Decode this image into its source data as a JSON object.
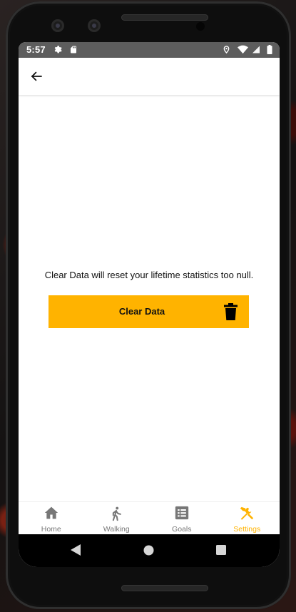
{
  "status_bar": {
    "time": "5:57",
    "left_icons": [
      "gear-icon",
      "sd-card-icon"
    ],
    "right_icons": [
      "location-icon",
      "wifi-icon",
      "signal-icon",
      "battery-icon"
    ]
  },
  "app_bar": {
    "back_icon": "arrow-left-icon"
  },
  "main": {
    "info_text": "Clear Data will reset your lifetime statistics too null.",
    "clear_button_label": "Clear Data",
    "clear_button_icon": "trash-icon"
  },
  "bottom_nav": {
    "items": [
      {
        "label": "Home",
        "icon": "home-icon"
      },
      {
        "label": "Walking",
        "icon": "walking-icon"
      },
      {
        "label": "Goals",
        "icon": "list-icon"
      },
      {
        "label": "Settings",
        "icon": "tools-icon"
      }
    ],
    "active_index": 3
  },
  "system_nav": [
    "back-triangle-icon",
    "home-circle-icon",
    "recents-square-icon"
  ],
  "colors": {
    "accent": "#ffb300",
    "status_bar": "#5d5d5d",
    "inactive_nav": "#777777",
    "system_nav": "#000000"
  }
}
